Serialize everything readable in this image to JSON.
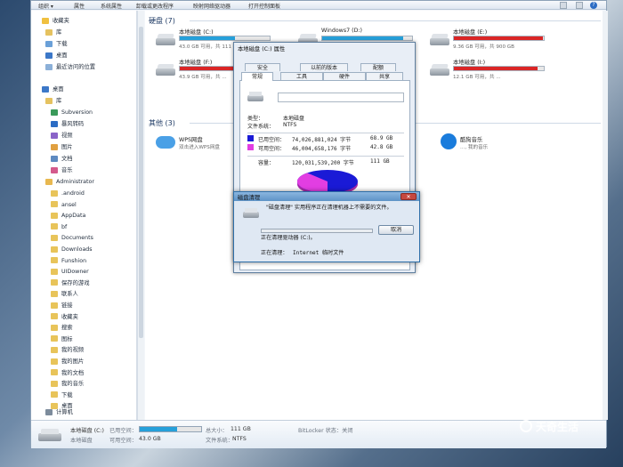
{
  "toolbar": {
    "items": [
      "组织 ▾",
      "属性",
      "系统属性",
      "卸载或更改程序",
      "映射网络驱动器",
      "打开控制面板"
    ]
  },
  "nav": {
    "favorites": {
      "label": "收藏夹",
      "items": [
        "库",
        "下载",
        "桌面",
        "最近访问的位置"
      ]
    },
    "desktop": "桌面",
    "libraries": {
      "label": "库",
      "items": [
        "Subversion",
        "暴风转码",
        "视频",
        "图片",
        "文档",
        "音乐"
      ]
    },
    "admin": {
      "label": "Administrator",
      "items": [
        ".android",
        "ansel",
        "AppData",
        "bf",
        "Documents",
        "Downloads",
        "Funshion",
        "UIDowner",
        "保存的游戏",
        "联系人",
        "链接",
        "收藏夹",
        "搜索",
        "图标",
        "我的视频",
        "我的图片",
        "我的文档",
        "我的音乐",
        "下载",
        "桌面"
      ]
    },
    "computer": "计算机"
  },
  "content": {
    "group_hdd": "硬盘 (7)",
    "group_other": "其他 (3)",
    "drives": [
      {
        "name": "本地磁盘 (C:)",
        "free": "43.0 GB 可用，共 111 GB",
        "used_pct": 61,
        "color": "#26a0da"
      },
      {
        "name": "Windows7 (D:)",
        "free": "",
        "used_pct": 90,
        "color": "#26a0da"
      },
      {
        "name": "本地磁盘 (E:)",
        "free": "9.36 GB 可用，共 900 GB",
        "used_pct": 99,
        "color": "#da2626"
      },
      {
        "name": "本地磁盘 (F:)",
        "free": "43.9 GB 可用，共 ...",
        "used_pct": 92,
        "color": "#da2626"
      },
      {
        "name": "本地磁盘 (H:)",
        "free": "16.6 GB 可用，共 277 GB",
        "used_pct": 94,
        "color": "#da2626"
      },
      {
        "name": "本地磁盘 (I:)",
        "free": "12.1 GB 可用，共 ...",
        "used_pct": 93,
        "color": "#da2626"
      }
    ],
    "wps": {
      "name": "WPS网盘",
      "sub": "双击进入WPS网盘"
    },
    "kugou": {
      "name": "酷狗音乐",
      "sub": "..., 我的音乐"
    }
  },
  "status": {
    "drive_name": "本地磁盘 (C:)",
    "drive_type": "本地磁盘",
    "used_label": "已用空间：",
    "free_label": "可用空间：",
    "free_value": "43.0 GB",
    "total_label": "总大小：",
    "total_value": "111 GB",
    "fs_label": "文件系统：",
    "fs_value": "NTFS",
    "bitlocker": "BitLocker 状态：关闭",
    "used_pct": 61
  },
  "props": {
    "title": "本地磁盘 (C:) 属性",
    "tabs_back": [
      "安全",
      "以前的版本",
      "配额"
    ],
    "tabs_front": [
      "常规",
      "工具",
      "硬件",
      "共享"
    ],
    "type_label": "类型：",
    "type_value": "本地磁盘",
    "fs_label": "文件系统：",
    "fs_value": "NTFS",
    "used_label": "已用空间：",
    "used_bytes": "74,026,881,024 字节",
    "used_gb": "68.9 GB",
    "free_label": "可用空间：",
    "free_bytes": "46,004,658,176 字节",
    "free_gb": "42.8 GB",
    "cap_label": "容量：",
    "cap_bytes": "120,031,539,200 字节",
    "cap_gb": "111 GB",
    "ok": "确定",
    "cancel": "取消",
    "used_color": "#1a1ad6",
    "free_color": "#e23ee2"
  },
  "disk_cleanup": {
    "title": "磁盘清理",
    "message": "\"磁盘清理\" 实用程序正在清理机器上不需要的文件。",
    "calculating": "正在清理驱动器 (C:)。",
    "cancel": "取消",
    "cleaning_label": "正在清理：",
    "cleaning_value": "Internet 临时文件",
    "close": "✕"
  },
  "watermark": "天奇生活"
}
